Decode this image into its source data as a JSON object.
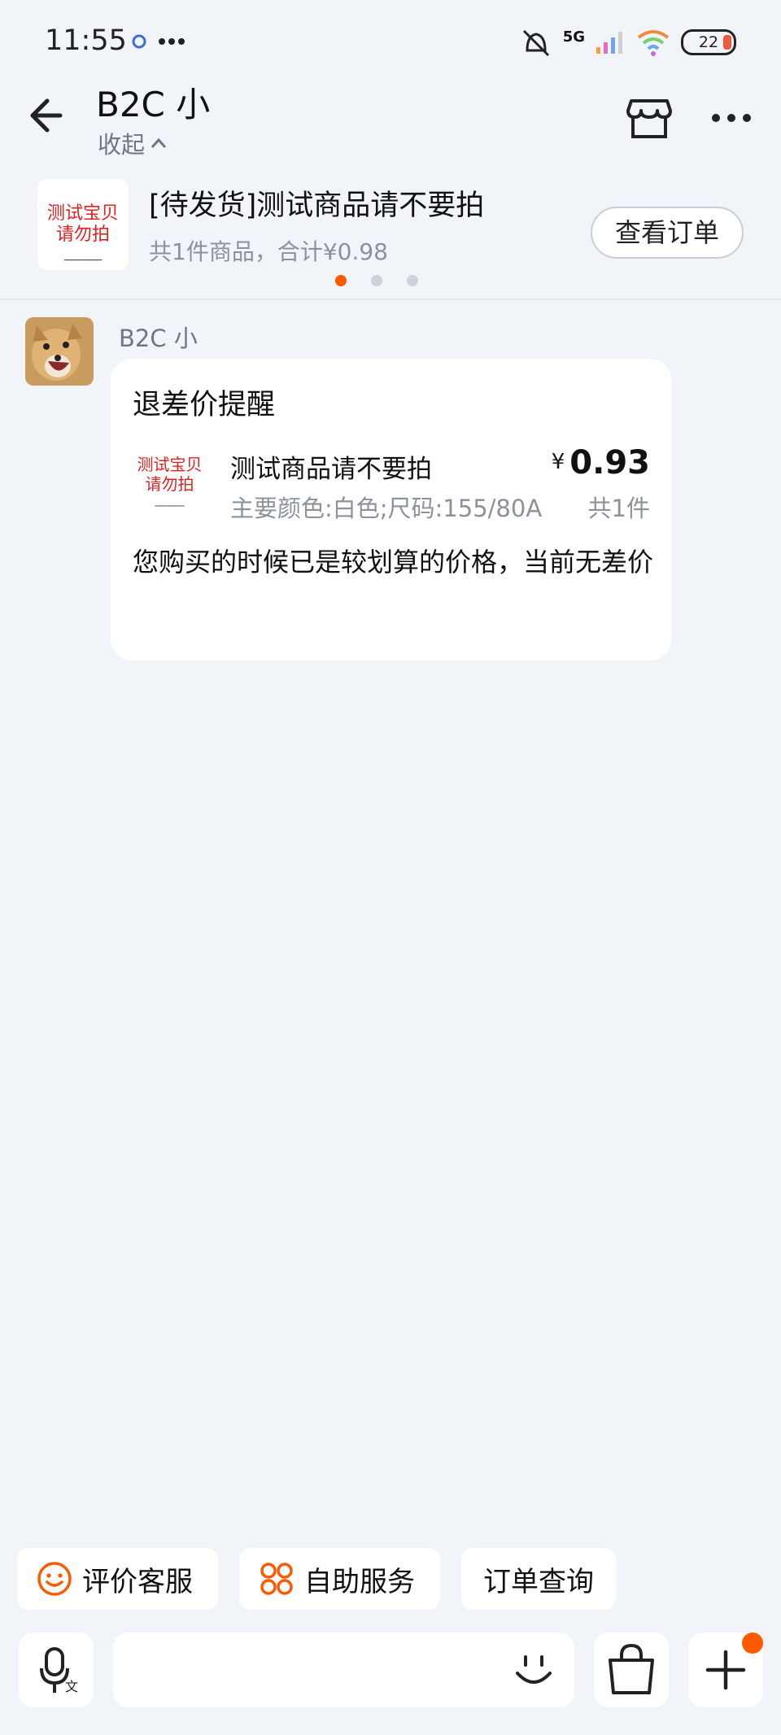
{
  "status": {
    "time": "11:55",
    "net": "5G",
    "battery": "22"
  },
  "header": {
    "title": "B2C 小",
    "collapse_label": "收起"
  },
  "order_card": {
    "thumb_text_line1": "测试宝贝",
    "thumb_text_line2": "请勿拍",
    "title": "[待发货]测试商品请不要拍",
    "summary": "共1件商品，合计¥0.98",
    "button": "查看订单"
  },
  "message": {
    "sender": "B2C 小",
    "card_title": "退差价提醒",
    "product_name": "测试商品请不要拍",
    "product_spec": "主要颜色:白色;尺码:155/80A",
    "currency": "¥",
    "price": "0.93",
    "quantity": "共1件",
    "body": "您购买的时候已是较划算的价格，当前无差价",
    "thumb_text_line1": "测试宝贝",
    "thumb_text_line2": "请勿拍"
  },
  "quick_actions": [
    {
      "label": "评价客服",
      "icon": "smile-icon"
    },
    {
      "label": "自助服务",
      "icon": "grid-icon"
    },
    {
      "label": "订单查询"
    }
  ],
  "colors": {
    "accent": "#ff5a00",
    "price_red": "#e02222",
    "bg": "#f1f4f8"
  }
}
